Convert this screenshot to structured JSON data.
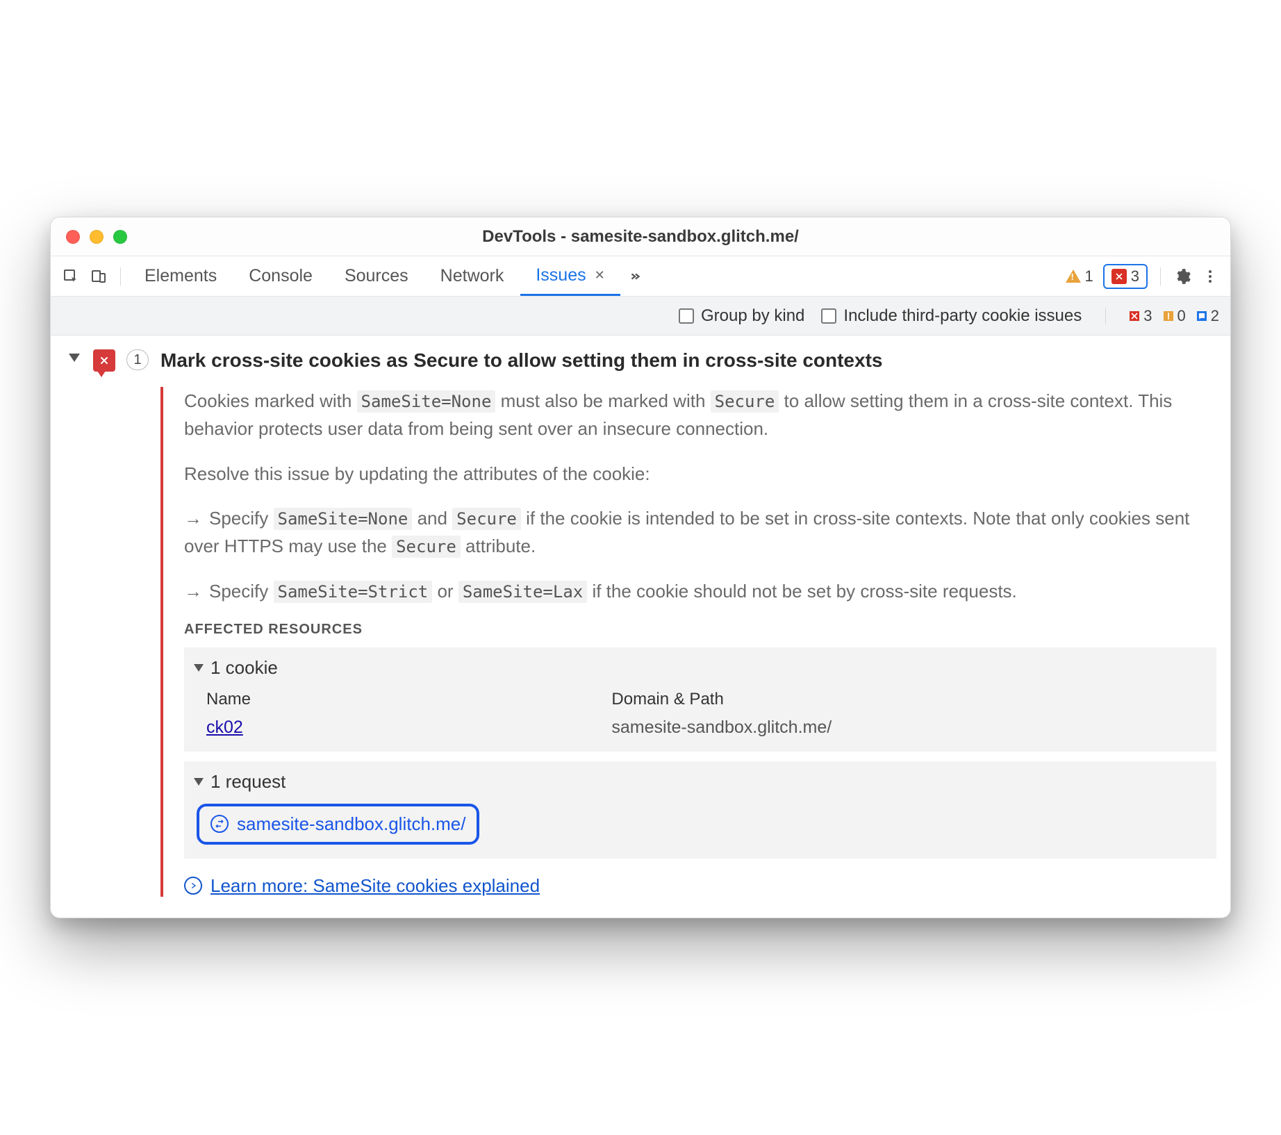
{
  "window": {
    "title": "DevTools - samesite-sandbox.glitch.me/"
  },
  "tabs": {
    "items": [
      "Elements",
      "Console",
      "Sources",
      "Network",
      "Issues"
    ],
    "activeIndex": 4
  },
  "topStatus": {
    "warning": "1",
    "error": "3"
  },
  "filter": {
    "groupByKind": "Group by kind",
    "includeThirdParty": "Include third-party cookie issues",
    "counts": {
      "error": "3",
      "warn": "0",
      "info": "2"
    }
  },
  "issue": {
    "count": "1",
    "title": "Mark cross-site cookies as Secure to allow setting them in cross-site contexts",
    "desc1a": "Cookies marked with ",
    "desc1code1": "SameSite=None",
    "desc1b": " must also be marked with ",
    "desc1code2": "Secure",
    "desc1c": " to allow setting them in a cross-site context. This behavior protects user data from being sent over an insecure connection.",
    "desc2": "Resolve this issue by updating the attributes of the cookie:",
    "b1a": "Specify ",
    "b1code1": "SameSite=None",
    "b1b": " and ",
    "b1code2": "Secure",
    "b1c": " if the cookie is intended to be set in cross-site contexts. Note that only cookies sent over HTTPS may use the ",
    "b1code3": "Secure",
    "b1d": " attribute.",
    "b2a": "Specify ",
    "b2code1": "SameSite=Strict",
    "b2b": " or ",
    "b2code2": "SameSite=Lax",
    "b2c": " if the cookie should not be set by cross-site requests.",
    "affectedHeading": "AFFECTED RESOURCES",
    "cookieHead": "1 cookie",
    "colName": "Name",
    "colDomain": "Domain & Path",
    "cookieName": "ck02",
    "cookieDomain": "samesite-sandbox.glitch.me/",
    "requestHead": "1 request",
    "requestUrl": "samesite-sandbox.glitch.me/",
    "learnMore": "Learn more: SameSite cookies explained"
  }
}
